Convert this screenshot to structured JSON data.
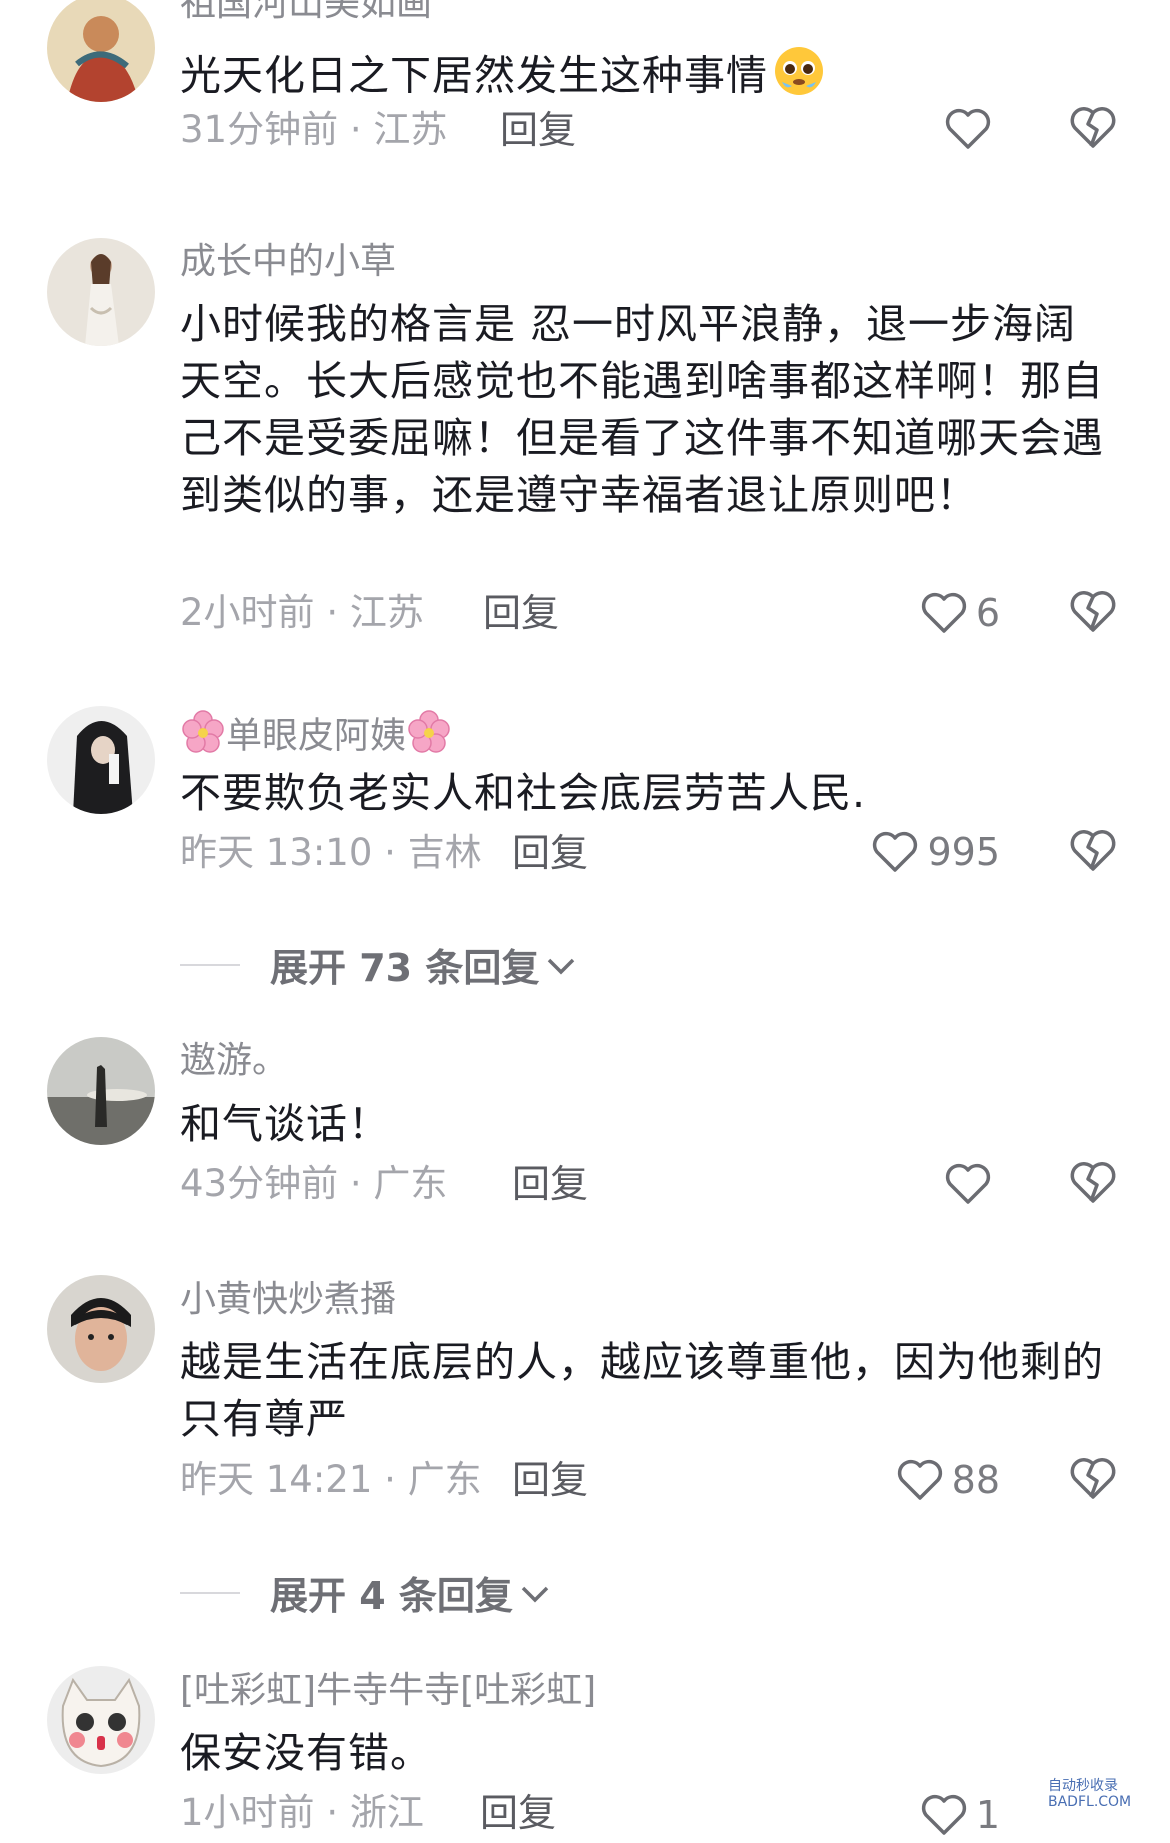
{
  "comments": [
    {
      "username": "祖国河山美如画",
      "text": "光天化日之下居然发生这种事情",
      "time": "31分钟前",
      "location": "江苏",
      "reply": "回复",
      "likes": ""
    },
    {
      "username": "成长中的小草",
      "text": "小时候我的格言是 忍一时风平浪静，退一步海阔天空。长大后感觉也不能遇到啥事都这样啊！那自己不是受委屈嘛！但是看了这件事不知道哪天会遇到类似的事，还是遵守幸福者退让原则吧！",
      "time": "2小时前",
      "location": "江苏",
      "reply": "回复",
      "likes": "6"
    },
    {
      "username": "单眼皮阿姨",
      "text": "不要欺负老实人和社会底层劳苦人民.",
      "time": "昨天 13:10",
      "location": "吉林",
      "reply": "回复",
      "likes": "995",
      "expand": "展开 73 条回复"
    },
    {
      "username": "遨游。",
      "text": "和气谈话！",
      "time": "43分钟前",
      "location": "广东",
      "reply": "回复",
      "likes": ""
    },
    {
      "username": "小黄快炒煮播",
      "text": "越是生活在底层的人，越应该尊重他，因为他剩的只有尊严",
      "time": "昨天 14:21",
      "location": "广东",
      "reply": "回复",
      "likes": "88",
      "expand": "展开 4 条回复"
    },
    {
      "username": "[吐彩虹]牛寺牛寺[吐彩虹]",
      "text": "保安没有错。",
      "time": "1小时前",
      "location": "浙江",
      "reply": "回复",
      "likes": "1"
    }
  ],
  "meta_separator": "·",
  "icons": {
    "like": "heart-outline-icon",
    "dislike": "broken-heart-icon",
    "expand": "chevron-down-icon",
    "username_decoration": "cherry-blossom-icon",
    "text_emoji": "pleading-face-emoji"
  },
  "watermark": {
    "line1": "自动秒收录",
    "line2": "BADFL.COM"
  }
}
